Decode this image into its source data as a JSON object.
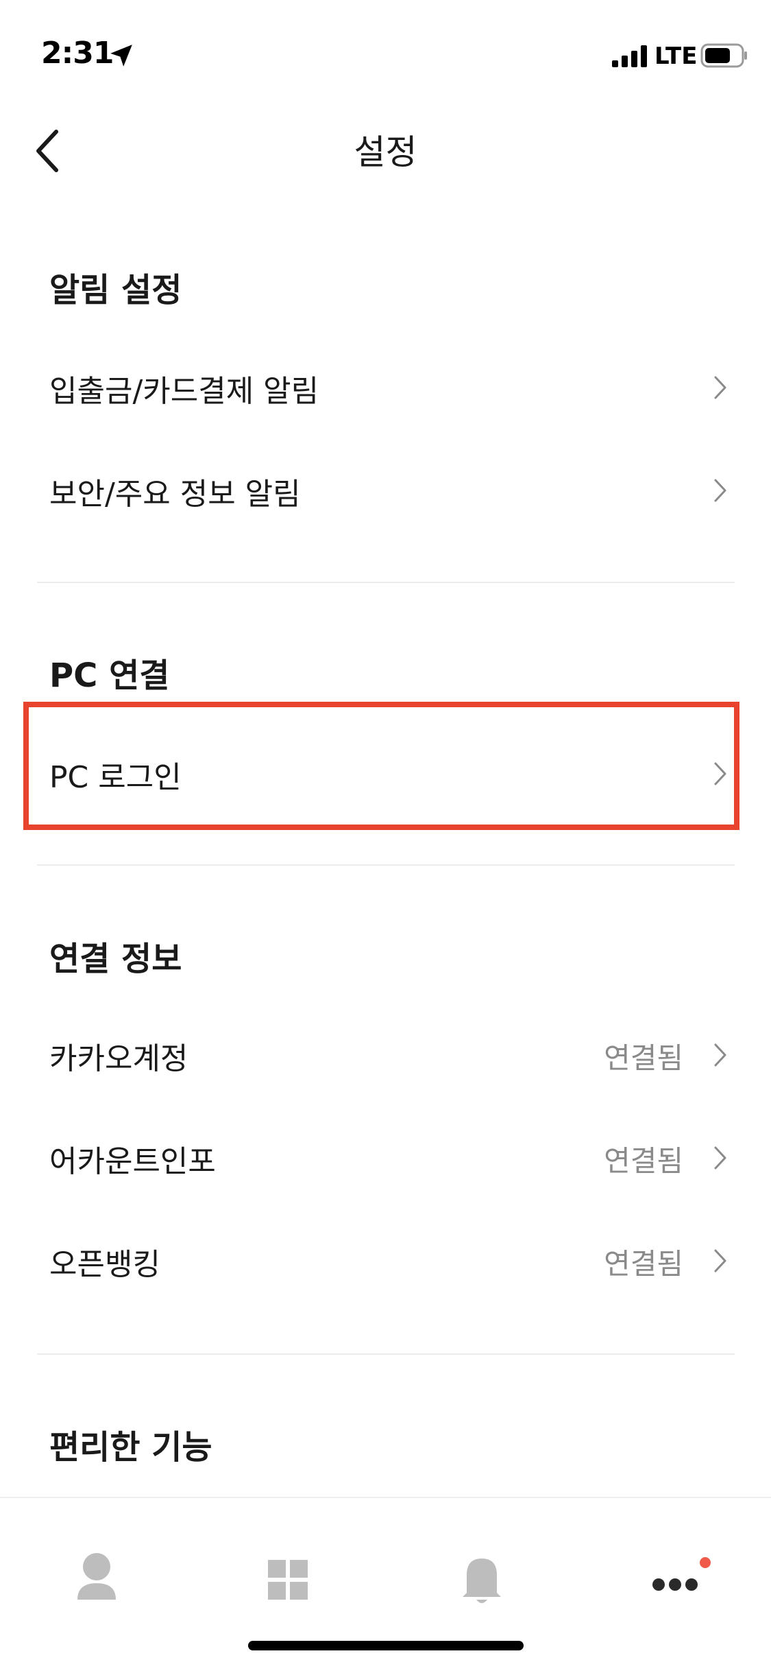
{
  "status_bar": {
    "time": "2:31",
    "network": "LTE",
    "icons": [
      "location-arrow-icon",
      "signal-icon",
      "battery-icon"
    ]
  },
  "header": {
    "title": "설정",
    "back_icon": "chevron-left-icon"
  },
  "sections": {
    "notifications": {
      "title": "알림 설정",
      "items": [
        {
          "label": "입출금/카드결제 알림"
        },
        {
          "label": "보안/주요 정보 알림"
        }
      ]
    },
    "pc": {
      "title": "PC 연결",
      "items": [
        {
          "label": "PC 로그인"
        }
      ]
    },
    "connections": {
      "title": "연결 정보",
      "items": [
        {
          "label": "카카오계정",
          "value": "연결됨"
        },
        {
          "label": "어카운트인포",
          "value": "연결됨"
        },
        {
          "label": "오픈뱅킹",
          "value": "연결됨"
        }
      ]
    },
    "features": {
      "title": "편리한 기능"
    }
  },
  "highlight_color": "#e8432d",
  "tab_bar": {
    "tabs": [
      {
        "icon": "person-icon"
      },
      {
        "icon": "grid-icon"
      },
      {
        "icon": "bell-icon"
      },
      {
        "icon": "more-dots-icon",
        "badge": true
      }
    ],
    "badge_color": "#f05a4a"
  }
}
